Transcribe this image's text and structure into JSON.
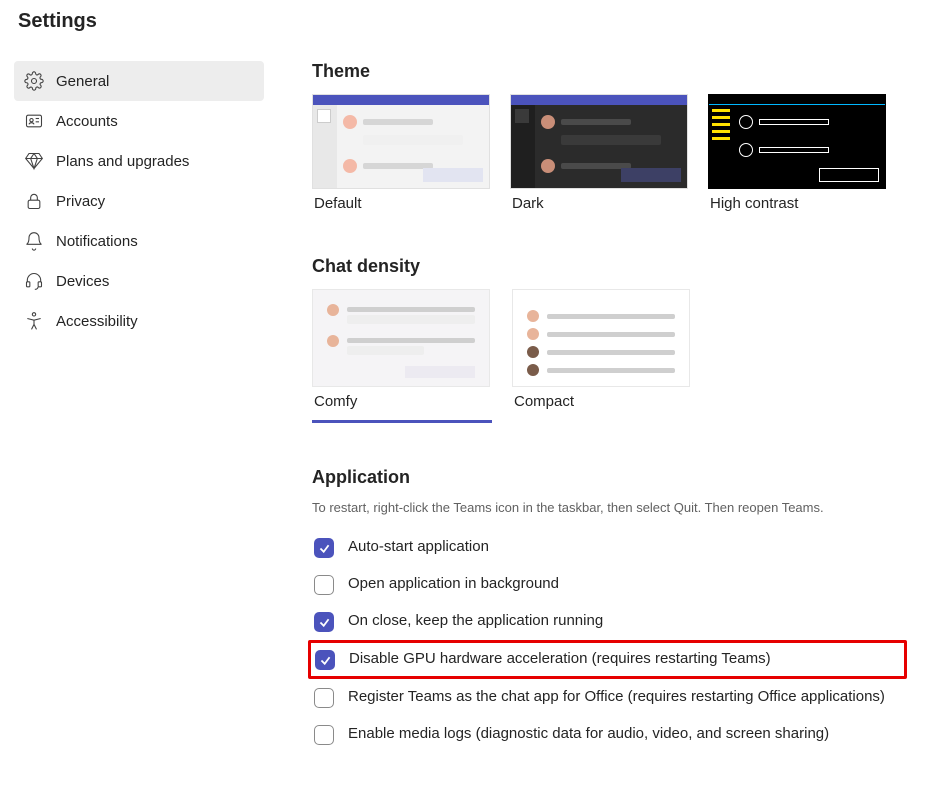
{
  "page_title": "Settings",
  "sidebar": {
    "items": [
      {
        "label": "General",
        "icon": "gear-icon",
        "active": true
      },
      {
        "label": "Accounts",
        "icon": "id-card-icon",
        "active": false
      },
      {
        "label": "Plans and upgrades",
        "icon": "diamond-icon",
        "active": false
      },
      {
        "label": "Privacy",
        "icon": "lock-icon",
        "active": false
      },
      {
        "label": "Notifications",
        "icon": "bell-icon",
        "active": false
      },
      {
        "label": "Devices",
        "icon": "headset-icon",
        "active": false
      },
      {
        "label": "Accessibility",
        "icon": "accessibility-icon",
        "active": false
      }
    ]
  },
  "theme": {
    "title": "Theme",
    "options": [
      {
        "label": "Default"
      },
      {
        "label": "Dark"
      },
      {
        "label": "High contrast"
      }
    ]
  },
  "chat_density": {
    "title": "Chat density",
    "options": [
      {
        "label": "Comfy",
        "selected": true
      },
      {
        "label": "Compact",
        "selected": false
      }
    ]
  },
  "application": {
    "title": "Application",
    "helper": "To restart, right-click the Teams icon in the taskbar, then select Quit. Then reopen Teams.",
    "settings": [
      {
        "label": "Auto-start application",
        "checked": true,
        "highlight": false
      },
      {
        "label": "Open application in background",
        "checked": false,
        "highlight": false
      },
      {
        "label": "On close, keep the application running",
        "checked": true,
        "highlight": false
      },
      {
        "label": "Disable GPU hardware acceleration (requires restarting Teams)",
        "checked": true,
        "highlight": true
      },
      {
        "label": "Register Teams as the chat app for Office (requires restarting Office applications)",
        "checked": false,
        "highlight": false
      },
      {
        "label": "Enable media logs (diagnostic data for audio, video, and screen sharing)",
        "checked": false,
        "highlight": false
      }
    ]
  }
}
